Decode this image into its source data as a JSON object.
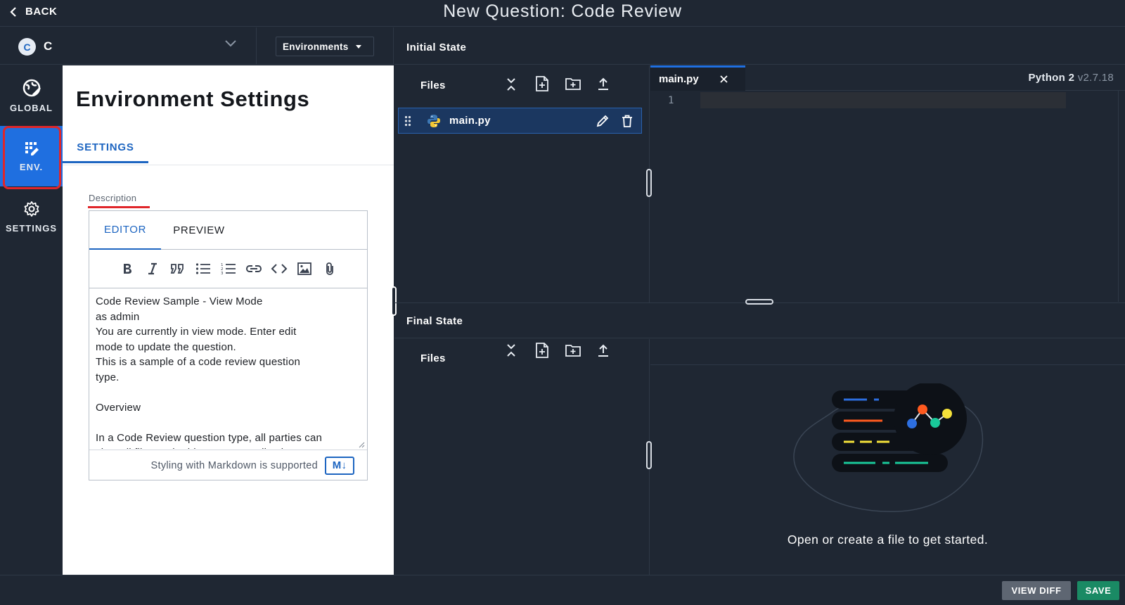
{
  "topbar": {
    "back_label": "BACK",
    "title": "New Question: Code Review"
  },
  "language": {
    "badge": "C",
    "name": "C"
  },
  "environments_dropdown": {
    "label": "Environments"
  },
  "nav": {
    "global_label": "GLOBAL",
    "env_label": "ENV.",
    "settings_label": "SETTINGS"
  },
  "panel": {
    "title": "Environment Settings",
    "tab": "SETTINGS",
    "description_label": "Description",
    "editor_tab": "EDITOR",
    "preview_tab": "PREVIEW",
    "toolbar_icons": [
      "bold-icon",
      "italic-icon",
      "quote-icon",
      "bullet-list-icon",
      "numbered-list-icon",
      "link-icon",
      "code-icon",
      "image-icon",
      "attachment-icon"
    ],
    "text_lines": [
      "Code Review Sample - View Mode",
      "as admin",
      "You are currently in view mode. Enter edit",
      "mode to update the question.",
      "This is a sample of a code review question",
      "type.",
      "",
      "Overview",
      "",
      "In a Code Review question type, all parties can",
      "view all files and add comments. Files in"
    ],
    "markdown_note": "Styling with Markdown is supported",
    "markdown_badge": "M↓"
  },
  "initial_state": {
    "title": "Initial State",
    "files_label": "Files",
    "file_name": "main.py",
    "code_tab": "main.py",
    "language_label": "Python 2",
    "language_version": "v2.7.18",
    "line_number": "1"
  },
  "final_state": {
    "title": "Final State",
    "files_label": "Files",
    "empty_message": "Open or create a file to get started."
  },
  "actions": {
    "view_diff": "VIEW DIFF",
    "save": "SAVE"
  },
  "colors": {
    "accent": "#1f6fe0",
    "save": "#1a8a64",
    "highlight": "#e0262a",
    "background": "#1f2733"
  }
}
